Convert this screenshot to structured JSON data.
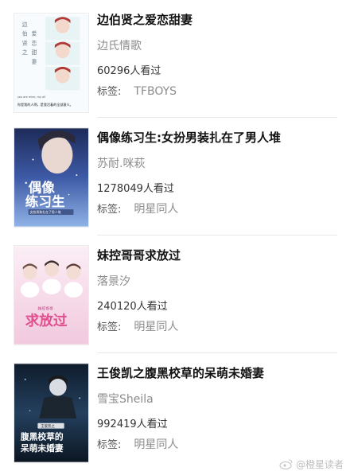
{
  "items": [
    {
      "title": "边伯贤之爱恋甜妻",
      "author": "边氏情歌",
      "views": "60296人看过",
      "tag_label": "标签:",
      "tag_value": "TFBOYS",
      "cover_text": "边伯贤之爱恋甜妻",
      "cover_caption": "你是我的人啊，是我活着的全部意义。",
      "cover_small": "you are mine, my all"
    },
    {
      "title": "偶像练习生:女扮男装扎在了男人堆",
      "author": "苏耐.咪萩",
      "views": "1278049人看过",
      "tag_label": "标签:",
      "tag_value": "明星同人",
      "cover_text": "偶像练习生",
      "cover_sub": "女扮男装扎在了男人堆"
    },
    {
      "title": "妹控哥哥求放过",
      "author": "落景汐",
      "views": "240120人看过",
      "tag_label": "标签:",
      "tag_value": "明星同人",
      "cover_text": "求放过",
      "cover_small": "妹控哥哥"
    },
    {
      "title": "王俊凯之腹黑校草的呆萌未婚妻",
      "author": "雪宝Sheila",
      "views": "992419人看过",
      "tag_label": "标签:",
      "tag_value": "明星同人",
      "cover_text": "腹黑校草的呆萌未婚妻",
      "cover_small": "王俊凯之"
    }
  ],
  "watermark": "@橙星读者",
  "colors": {
    "title": "#111111",
    "author": "#8c8c8c",
    "divider": "#e8e8e8",
    "cover2_bg": "#2a3f7a",
    "cover3_bg": "#f6dbe9",
    "cover4_bg": "#1b2c3e"
  }
}
